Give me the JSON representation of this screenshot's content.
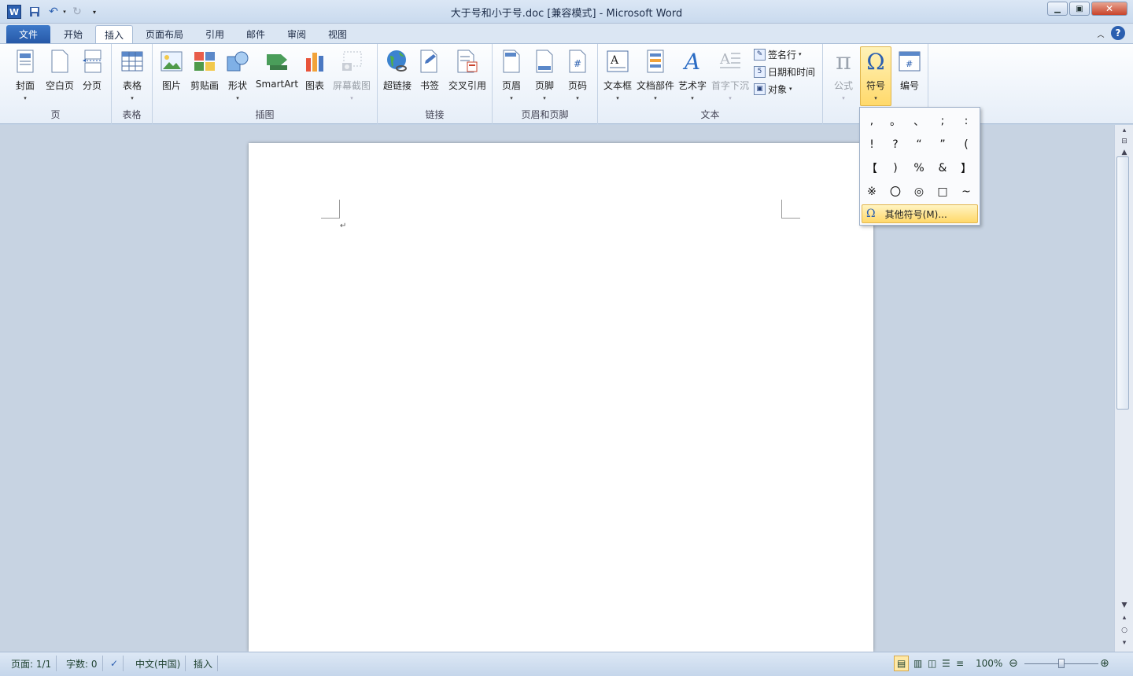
{
  "window": {
    "title": "大于号和小于号.doc [兼容模式]  -  Microsoft Word",
    "app_icon": "W"
  },
  "tabs": [
    {
      "label": "文件"
    },
    {
      "label": "开始"
    },
    {
      "label": "插入"
    },
    {
      "label": "页面布局"
    },
    {
      "label": "引用"
    },
    {
      "label": "邮件"
    },
    {
      "label": "审阅"
    },
    {
      "label": "视图"
    }
  ],
  "ribbon": {
    "page": {
      "label": "页",
      "buttons": [
        "封面",
        "空白页",
        "分页"
      ]
    },
    "table": {
      "label": "表格",
      "buttons": [
        "表格"
      ]
    },
    "illustrations": {
      "label": "插图",
      "buttons": [
        "图片",
        "剪贴画",
        "形状",
        "SmartArt",
        "图表",
        "屏幕截图"
      ]
    },
    "links": {
      "label": "链接",
      "buttons": [
        "超链接",
        "书签",
        "交叉引用"
      ]
    },
    "header_footer": {
      "label": "页眉和页脚",
      "buttons": [
        "页眉",
        "页脚",
        "页码"
      ]
    },
    "text": {
      "label": "文本",
      "buttons": [
        "文本框",
        "文档部件",
        "艺术字",
        "首字下沉"
      ],
      "small": [
        "签名行",
        "日期和时间",
        "对象"
      ]
    },
    "symbols": {
      "buttons": [
        "公式",
        "符号",
        "编号"
      ]
    }
  },
  "symbol_menu": {
    "symbols": [
      ",",
      "。",
      "、",
      ";",
      ":",
      "!",
      "?",
      "“",
      "”",
      "(",
      "【",
      ")",
      "%",
      "&",
      "】",
      "※",
      "〇",
      "◎",
      "□",
      "~"
    ],
    "more_label": "其他符号(M)..."
  },
  "status": {
    "page": "页面: 1/1",
    "words": "字数: 0",
    "language": "中文(中国)",
    "mode": "插入",
    "zoom": "100%",
    "zoom_level": 0.5
  },
  "colors": {
    "accent": "#2759a8",
    "highlight": "#ffd96b"
  }
}
